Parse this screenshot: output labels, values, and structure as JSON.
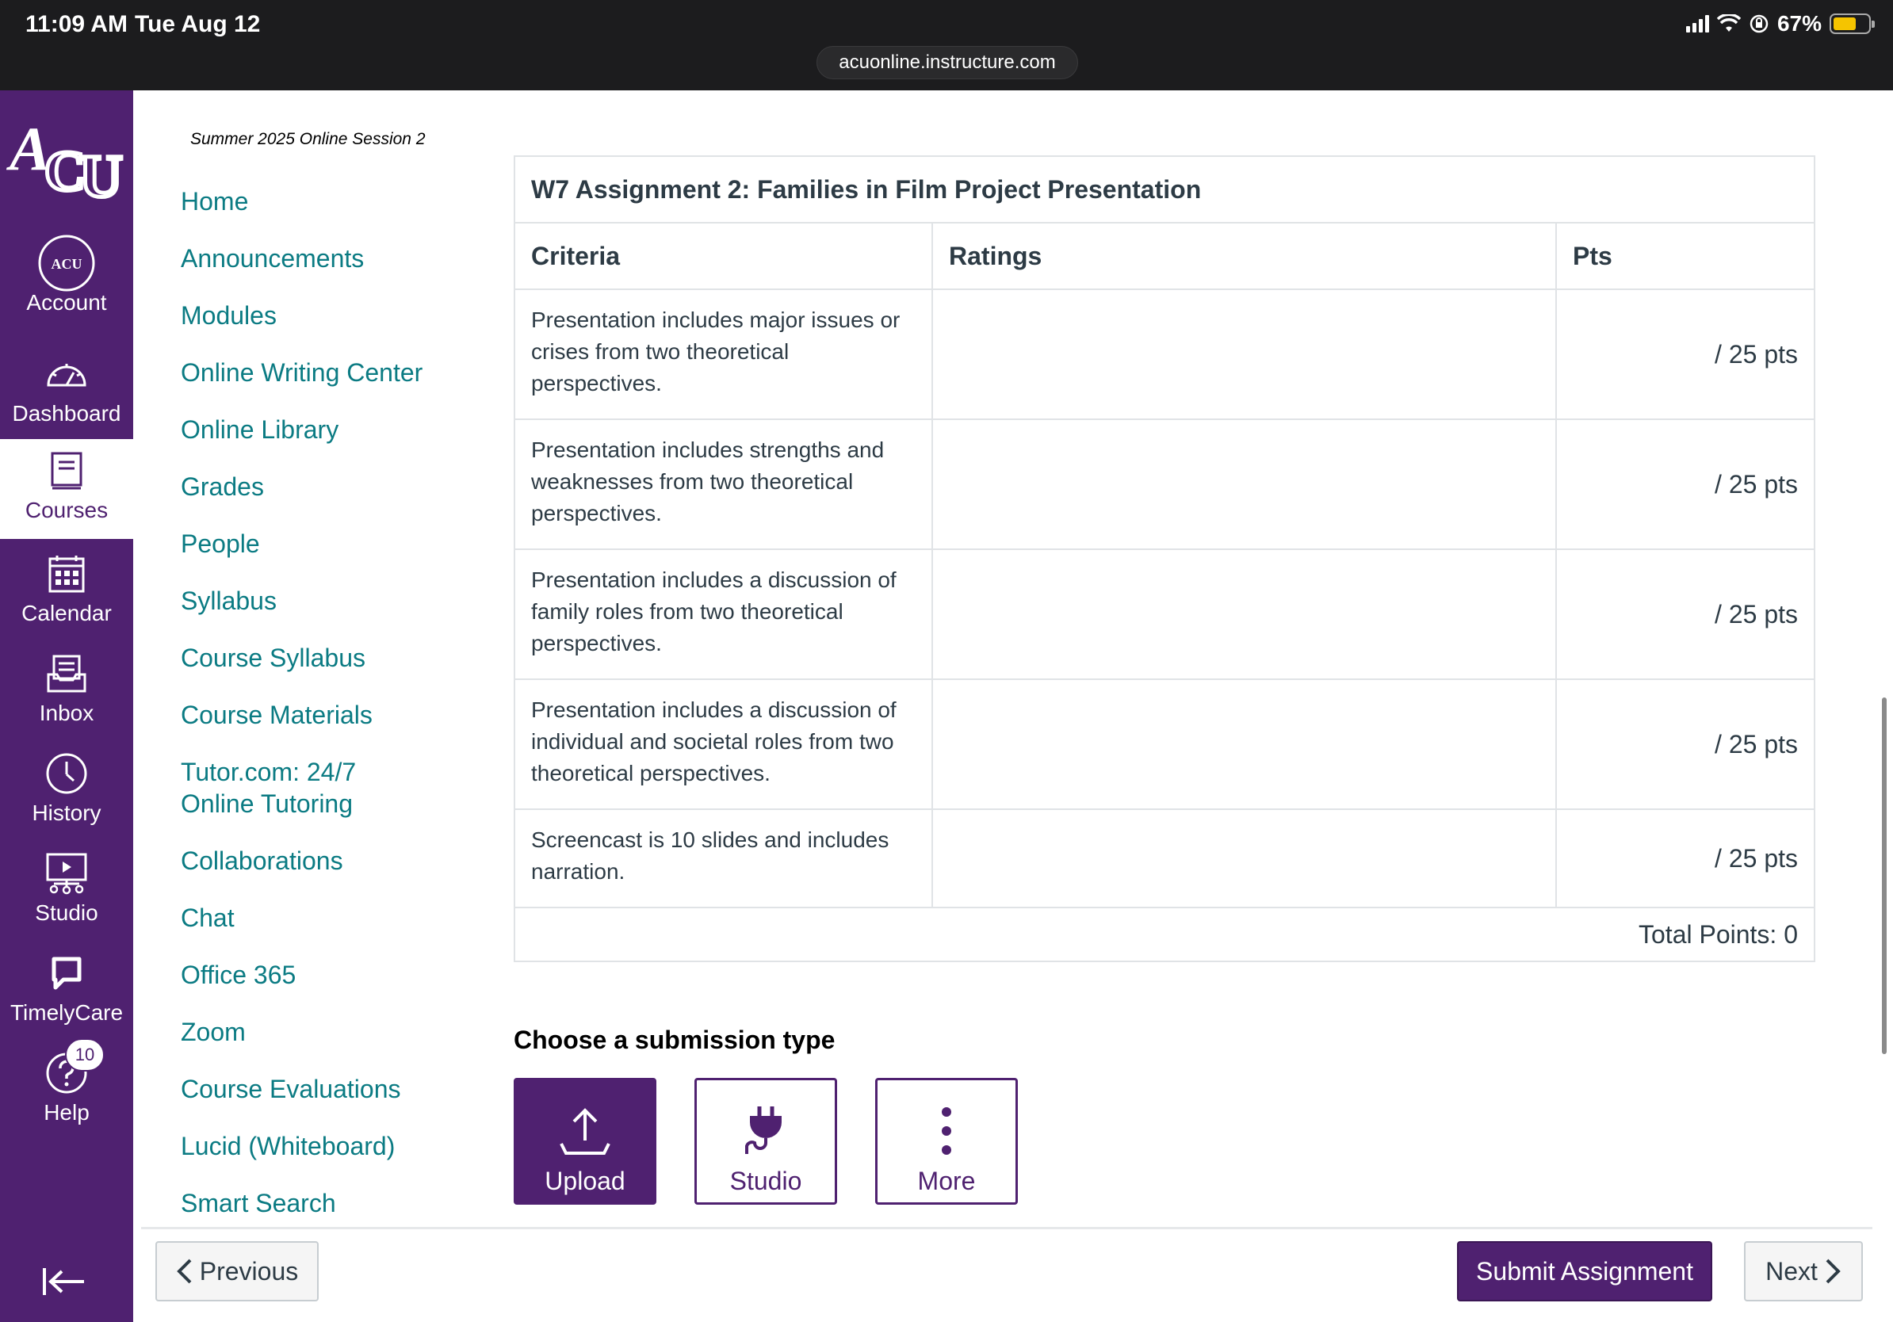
{
  "status_bar": {
    "time": "11:09 AM",
    "date": "Tue Aug 12",
    "battery": "67%",
    "battery_level": 0.67,
    "url": "acuonline.instructure.com"
  },
  "global_nav": {
    "logo": "ACU",
    "items": [
      {
        "label": "Account",
        "icon": "account-avatar-icon"
      },
      {
        "label": "Dashboard",
        "icon": "dashboard-gauge-icon"
      },
      {
        "label": "Courses",
        "icon": "courses-book-icon",
        "active": true
      },
      {
        "label": "Calendar",
        "icon": "calendar-icon"
      },
      {
        "label": "Inbox",
        "icon": "inbox-icon"
      },
      {
        "label": "History",
        "icon": "history-clock-icon"
      },
      {
        "label": "Studio",
        "icon": "studio-icon"
      },
      {
        "label": "TimelyCare",
        "icon": "timelycare-icon"
      },
      {
        "label": "Help",
        "icon": "help-icon",
        "badge": "10"
      }
    ]
  },
  "course_nav": {
    "term": "Summer 2025 Online Session 2",
    "items": [
      "Home",
      "Announcements",
      "Modules",
      "Online Writing Center",
      "Online Library",
      "Grades",
      "People",
      "Syllabus",
      "Course Syllabus",
      "Course Materials",
      "Tutor.com: 24/7",
      "Online Tutoring",
      "Collaborations",
      "Chat",
      "Office 365",
      "Zoom",
      "Course Evaluations",
      "Lucid (Whiteboard)",
      "Smart Search"
    ]
  },
  "rubric": {
    "title": "W7 Assignment 2: Families in Film Project Presentation",
    "headers": {
      "criteria": "Criteria",
      "ratings": "Ratings",
      "pts": "Pts"
    },
    "rows": [
      {
        "criteria": "Presentation includes major issues or crises from two theoretical perspectives.",
        "pts": "/ 25 pts"
      },
      {
        "criteria": "Presentation includes strengths and weaknesses from two theoretical perspectives.",
        "pts": "/ 25 pts"
      },
      {
        "criteria": "Presentation includes a discussion of family roles from two theoretical perspectives.",
        "pts": "/ 25 pts"
      },
      {
        "criteria": "Presentation includes a discussion of individual and societal roles from two theoretical perspectives.",
        "pts": "/ 25 pts"
      },
      {
        "criteria": "Screencast is 10 slides and includes narration.",
        "pts": "/ 25 pts"
      }
    ],
    "total": "Total Points: 0"
  },
  "submission": {
    "title": "Choose a submission type",
    "options": [
      {
        "label": "Upload",
        "icon": "upload-icon",
        "selected": true
      },
      {
        "label": "Studio",
        "icon": "plug-icon"
      },
      {
        "label": "More",
        "icon": "more-vertical-icon"
      }
    ]
  },
  "footer": {
    "previous": "Previous",
    "submit": "Submit Assignment",
    "next": "Next"
  },
  "colors": {
    "brand_purple": "#4f2170",
    "link_teal": "#0b7b83",
    "text": "#2d3b45",
    "border": "#e0e3e6"
  }
}
